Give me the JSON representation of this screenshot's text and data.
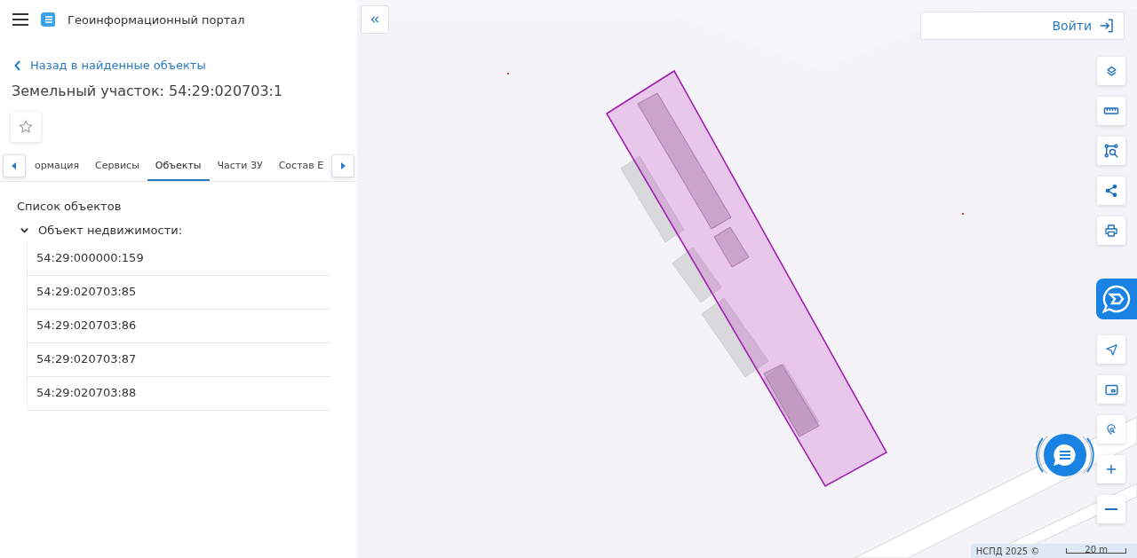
{
  "header": {
    "title": "Геоинформационный портал"
  },
  "back_link": "Назад в найденные объекты",
  "page_title": "Земельный участок: 54:29:020703:1",
  "favorite": {
    "selected": false
  },
  "tabs": [
    {
      "label": "ормация",
      "selected": false
    },
    {
      "label": "Сервисы",
      "selected": false
    },
    {
      "label": "Объекты",
      "selected": true
    },
    {
      "label": "Части ЗУ",
      "selected": false
    },
    {
      "label": "Состав Е",
      "selected": false
    }
  ],
  "objects_list": {
    "title": "Список объектов",
    "groups": [
      {
        "label": "Объект недвижимости:",
        "expanded": true,
        "children": [
          {
            "label": "54:29:000000:159"
          },
          {
            "label": "54:29:020703:85"
          },
          {
            "label": "54:29:020703:86"
          },
          {
            "label": "54:29:020703:87"
          },
          {
            "label": "54:29:020703:88"
          }
        ]
      }
    ]
  },
  "map": {
    "login_button": "Войти",
    "copyright": "НСПД 2025 ©",
    "scale": "20 m"
  }
}
